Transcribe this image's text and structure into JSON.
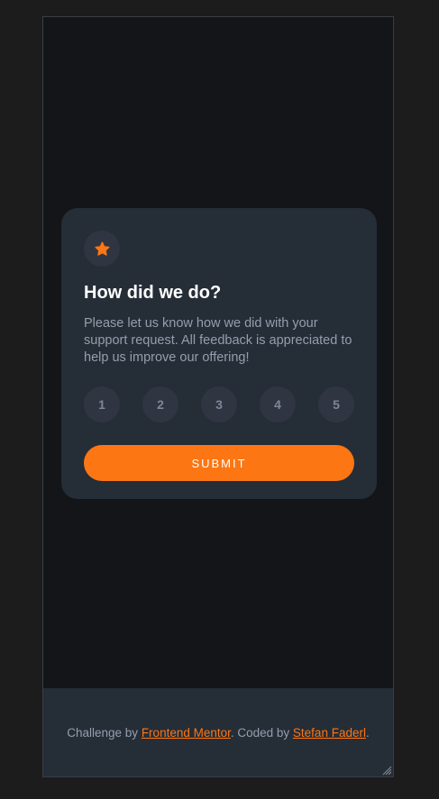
{
  "card": {
    "icon": "star-icon",
    "title": "How did we do?",
    "description": "Please let us know how we did with your support request. All feedback is appreciated to help us improve our offering!",
    "ratings": [
      "1",
      "2",
      "3",
      "4",
      "5"
    ],
    "submit_label": "SUBMIT"
  },
  "footer": {
    "prefix": "Challenge by ",
    "challenge_link": "Frontend Mentor",
    "middle": ". Coded by ",
    "author_link": "Stefan Faderl",
    "suffix": "."
  },
  "colors": {
    "accent": "#fc7614",
    "card_bg": "#252d37",
    "page_bg": "#131518",
    "muted_text": "#959eac"
  }
}
